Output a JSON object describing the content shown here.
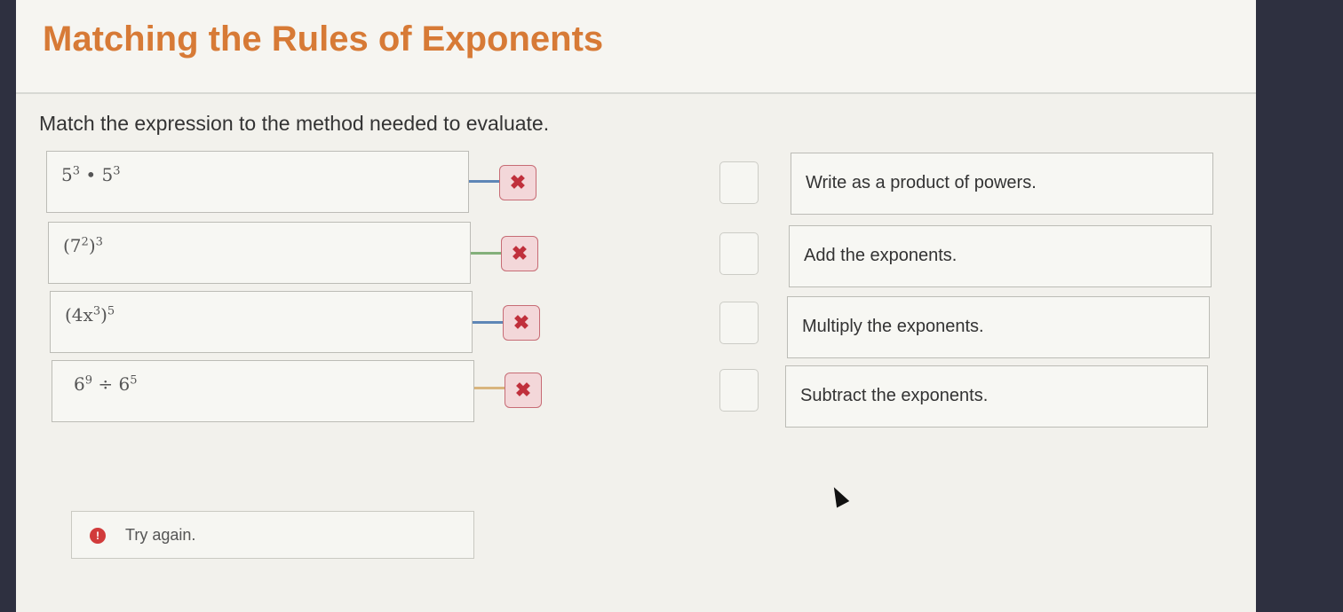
{
  "page": {
    "title": "Matching the Rules of Exponents",
    "instruction": "Match the expression to the method needed to evaluate."
  },
  "expressions": [
    {
      "base1": "5",
      "exp1": "3",
      "op": " • ",
      "base2": "5",
      "exp2": "3"
    },
    {
      "open": "(7",
      "inner_exp": "2",
      "close": ")",
      "outer_exp": "3"
    },
    {
      "open": "(4x",
      "inner_exp": "3",
      "close": ")",
      "outer_exp": "5"
    },
    {
      "base1": "6",
      "exp1": "9",
      "op": " ÷ ",
      "base2": "6",
      "exp2": "5"
    }
  ],
  "remove_glyph": "✖",
  "methods": [
    "Write as a product of powers.",
    "Add the exponents.",
    "Multiply the exponents.",
    "Subtract the exponents."
  ],
  "connector_colors": [
    "#5e86b6",
    "#83b07a",
    "#5e86b6",
    "#d9b57d"
  ],
  "feedback": {
    "icon": "!",
    "text": "Try again."
  },
  "colors": {
    "title": "#d77a36",
    "error": "#d13b3b"
  }
}
